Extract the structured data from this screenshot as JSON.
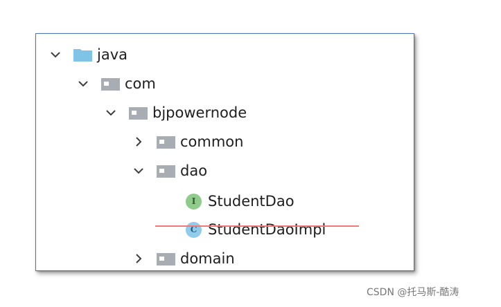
{
  "tree": {
    "items": [
      {
        "label": "java",
        "expanded": true,
        "icon": "source-folder-icon"
      },
      {
        "label": "com",
        "expanded": true,
        "icon": "package-folder-icon"
      },
      {
        "label": "bjpowernode",
        "expanded": true,
        "icon": "package-folder-icon"
      },
      {
        "label": "common",
        "expanded": false,
        "icon": "package-folder-icon"
      },
      {
        "label": "dao",
        "expanded": true,
        "icon": "package-folder-icon"
      },
      {
        "label": "StudentDao",
        "icon": "interface-icon",
        "icon_letter": "I"
      },
      {
        "label": "StudentDaoImpl",
        "icon": "class-icon",
        "icon_letter": "C",
        "struck": true
      },
      {
        "label": "domain",
        "expanded": false,
        "icon": "package-folder-icon"
      }
    ]
  },
  "watermark": {
    "text": "CSDN @托马斯-酷涛"
  },
  "colors": {
    "source_folder": "#7fc4e6",
    "package_folder": "#a8adb3",
    "interface_icon_bg": "#8fcb8b",
    "class_icon_bg": "#8fcbea",
    "strike_line": "#f07a7a"
  }
}
